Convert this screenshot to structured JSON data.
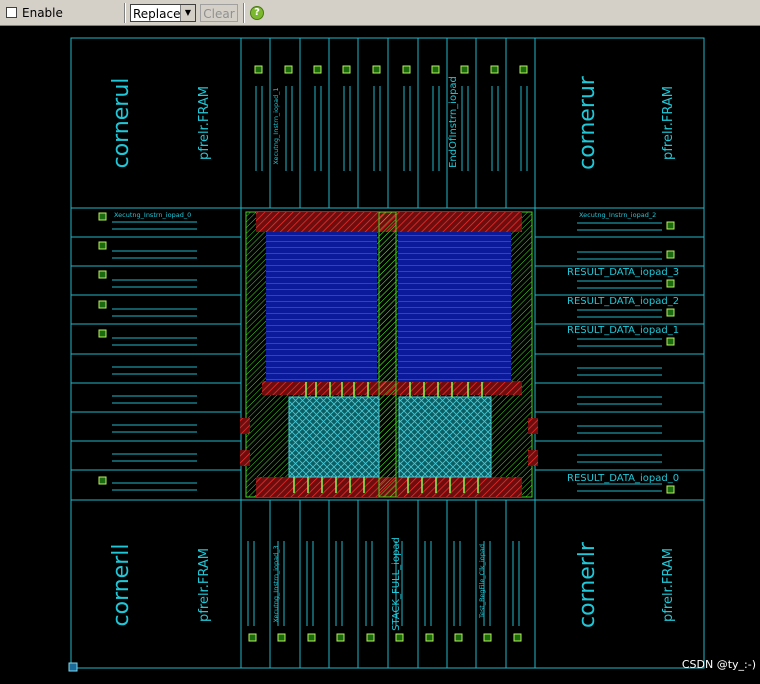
{
  "toolbar": {
    "enable_label": "Enable",
    "mode_select_value": "Replace",
    "clear_label": "Clear",
    "help_icon": "help-icon"
  },
  "corners": {
    "ul": {
      "name": "cornerul",
      "cell": "pfrelr.FRAM"
    },
    "ur": {
      "name": "cornerur",
      "cell": "pfrelr.FRAM"
    },
    "ll": {
      "name": "cornerll",
      "cell": "pfrelr.FRAM"
    },
    "lr": {
      "name": "cornerlr",
      "cell": "pfrelr.FRAM"
    }
  },
  "pads": {
    "top_1": "Xecutng_Instrn_iopad_1",
    "top_2": "EndOfInstrn_iopad",
    "left_0": "Xecutng_Instrn_iopad_0",
    "right_2": "Xecutng_Instrn_iopad_2",
    "right_3": "RESULT_DATA_iopad_3",
    "right_4": "RESULT_DATA_iopad_2",
    "right_5": "RESULT_DATA_iopad_1",
    "right_6": "RESULT_DATA_iopad_0",
    "bottom_1": "Xecutng_Instrn_iopad_3",
    "bottom_2": "STACK_FULL_iopad",
    "bottom_3": "Test_RegFile_Clk_iopad"
  },
  "watermark": "CSDN @ty_:-)"
}
